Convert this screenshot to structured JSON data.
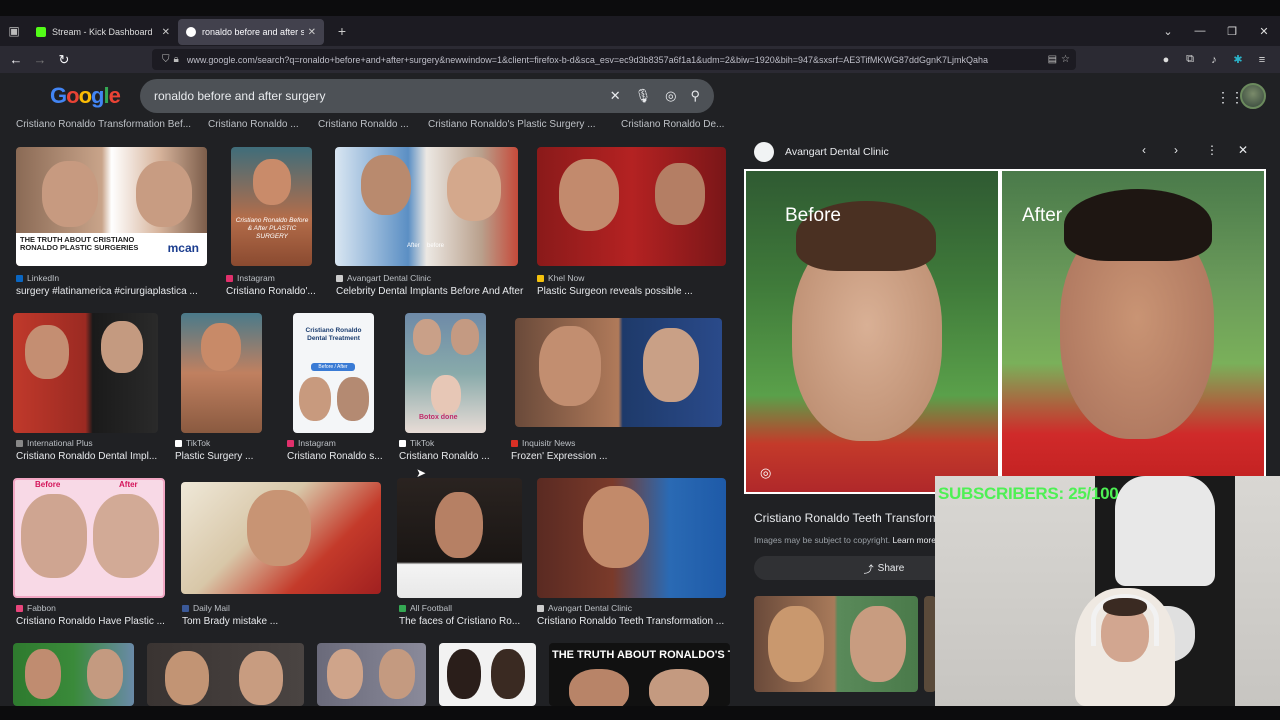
{
  "browser": {
    "tabs": [
      {
        "label": "Stream - Kick Dashboard",
        "fav_color": "#53fc18"
      },
      {
        "label": "ronaldo before and after surgery",
        "fav_color": "#ffffff"
      }
    ],
    "url": "www.google.com/search?q=ronaldo+before+and+after+surgery&newwindow=1&client=firefox-b-d&sca_esv=ec9d3b8357a6f1a1&udm=2&biw=1920&bih=947&sxsrf=AE3TifMKWG87ddGgnK7LjmkQaha"
  },
  "search": {
    "logo": "Google",
    "query": "ronaldo before and after surgery"
  },
  "chips": [
    "Cristiano Ronaldo Transformation Bef...",
    "Cristiano Ronaldo ...",
    "Cristiano Ronaldo ...",
    "Cristiano Ronaldo's Plastic Surgery ...",
    "Cristiano Ronaldo De..."
  ],
  "results": [
    {
      "source": "LinkedIn",
      "title": "surgery #latinamerica #cirurgiaplastica ...",
      "src_color": "#0a66c2",
      "img_text": "THE TRUTH ABOUT CRISTIANO RONALDO PLASTIC SURGERIES",
      "img_text2": "mcan"
    },
    {
      "source": "Instagram",
      "title": "Cristiano Ronaldo'...",
      "src_color": "#e1306c",
      "img_text": "Cristiano Ronaldo Before & After PLASTIC SURGERY"
    },
    {
      "source": "Avangart Dental Clinic",
      "title": "Celebrity Dental Implants Before And After",
      "src_color": "#cccccc",
      "img_text": "After",
      "img_text2": "before"
    },
    {
      "source": "Khel Now",
      "title": "Plastic Surgeon reveals possible ...",
      "src_color": "#f4c20d"
    },
    {
      "source": "International Plus",
      "title": "Cristiano Ronaldo Dental Impl...",
      "src_color": "#888888"
    },
    {
      "source": "TikTok",
      "title": "Plastic Surgery ...",
      "src_color": "#ffffff"
    },
    {
      "source": "Instagram",
      "title": "Cristiano Ronaldo s...",
      "src_color": "#e1306c",
      "img_text": "Cristiano Ronaldo Dental Treatment",
      "img_text2": "Before / After"
    },
    {
      "source": "TikTok",
      "title": "Cristiano Ronaldo ...",
      "src_color": "#ffffff",
      "img_text": "Botox done"
    },
    {
      "source": "Inquisitr News",
      "title": "Frozen' Expression ...",
      "src_color": "#d93025"
    },
    {
      "source": "Fabbon",
      "title": "Cristiano Ronaldo Have Plastic ...",
      "src_color": "#e8457c",
      "img_text": "Before",
      "img_text2": "After"
    },
    {
      "source": "Daily Mail",
      "title": "Tom Brady mistake ...",
      "src_color": "#3b5998"
    },
    {
      "source": "All Football",
      "title": "The faces of Cristiano Ro...",
      "src_color": "#34a853"
    },
    {
      "source": "Avangart Dental Clinic",
      "title": "Cristiano Ronaldo Teeth Transformation ...",
      "src_color": "#cccccc"
    }
  ],
  "bottom_banner": "THE TRUTH ABOUT RONALDO'S TEET",
  "panel": {
    "source": "Avangart Dental Clinic",
    "before_label": "Before",
    "after_label": "After",
    "title": "Cristiano Ronaldo Teeth Transform",
    "copyright": "Images may be subject to copyright.",
    "learn_more": "Learn more",
    "share_label": "Share"
  },
  "overlay": {
    "subscribers": "SUBSCRIBERS: 25/100"
  }
}
